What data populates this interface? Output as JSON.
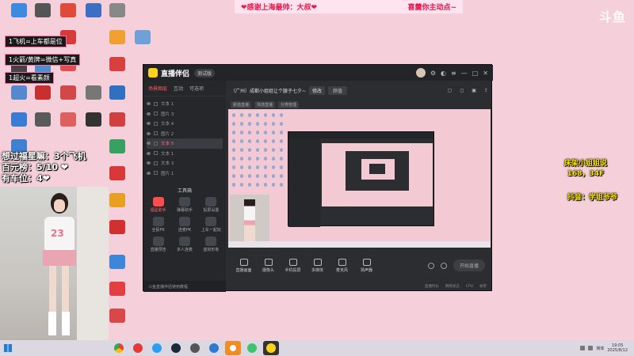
{
  "banner": {
    "left_text": "❤感谢上海最帅：大叔❤",
    "right_text": "喜羹你主动点~"
  },
  "watermark": "斗鱼",
  "notes": [
    "1飞机=上车都是位",
    "1火箭/黄牌=微信+写真",
    "1超火=看素颜"
  ],
  "wish_list": [
    "想过福星嘛：3个飞机",
    "百元榜：5/10 ❤",
    "有车位：4❤"
  ],
  "webcam": {
    "jersey_number": "23"
  },
  "app": {
    "title": "直播伴侣",
    "version": "测试版",
    "left_tabs": [
      "场景图层",
      "互动",
      "可选项"
    ],
    "layers": [
      {
        "label": "文本 1",
        "selected": false
      },
      {
        "label": "图片 3",
        "selected": false
      },
      {
        "label": "文本 4",
        "selected": false
      },
      {
        "label": "图片 2",
        "selected": false
      },
      {
        "label": "文本 5",
        "selected": true
      },
      {
        "label": "文本 1",
        "selected": false
      },
      {
        "label": "文本 3",
        "selected": false
      },
      {
        "label": "图片 1",
        "selected": false
      }
    ],
    "tools_title": "工具箱",
    "tools": [
      {
        "label": "福星助手",
        "hot": true
      },
      {
        "label": "弹幕助手",
        "hot": false
      },
      {
        "label": "投屏设置",
        "hot": false
      },
      {
        "label": "全民PK",
        "hot": false
      },
      {
        "label": "连麦PK",
        "hot": false
      },
      {
        "label": "上车一起玩",
        "hot": false
      },
      {
        "label": "直播预告",
        "hot": false
      },
      {
        "label": "多人连麦",
        "hot": false
      },
      {
        "label": "虚拟形象",
        "hot": false
      }
    ],
    "left_footer": "斗鱼直播伴侣使用教程",
    "room_title": "（广州）成都小姐姐让个腰子七夕~",
    "edit_label": "修改",
    "category": "颜值",
    "tags": [
      "颜值直播",
      "情感直播",
      "分类管理"
    ],
    "bottom_controls": [
      "直播画面",
      "摄像头",
      "手机投屏",
      "多媒体",
      "麦克风",
      "扬声器"
    ],
    "start_label": "开始直播",
    "status_items": [
      "直播时长",
      "网络状态",
      "CPU",
      "帧率"
    ]
  },
  "right_info": {
    "line1": "床架小姐姐说",
    "line2": "168，34F",
    "douyin": "抖音：学姐爷爷"
  },
  "taskbar": {
    "clock_time": "19:05",
    "clock_date": "2025/8/12",
    "tray_text": "简体"
  },
  "colors": {
    "desktop_bg": "#f5d0da",
    "app_bg": "#2b2d31",
    "accent_red": "#ff4d4d",
    "overlay_yellow": "#ffe600"
  }
}
